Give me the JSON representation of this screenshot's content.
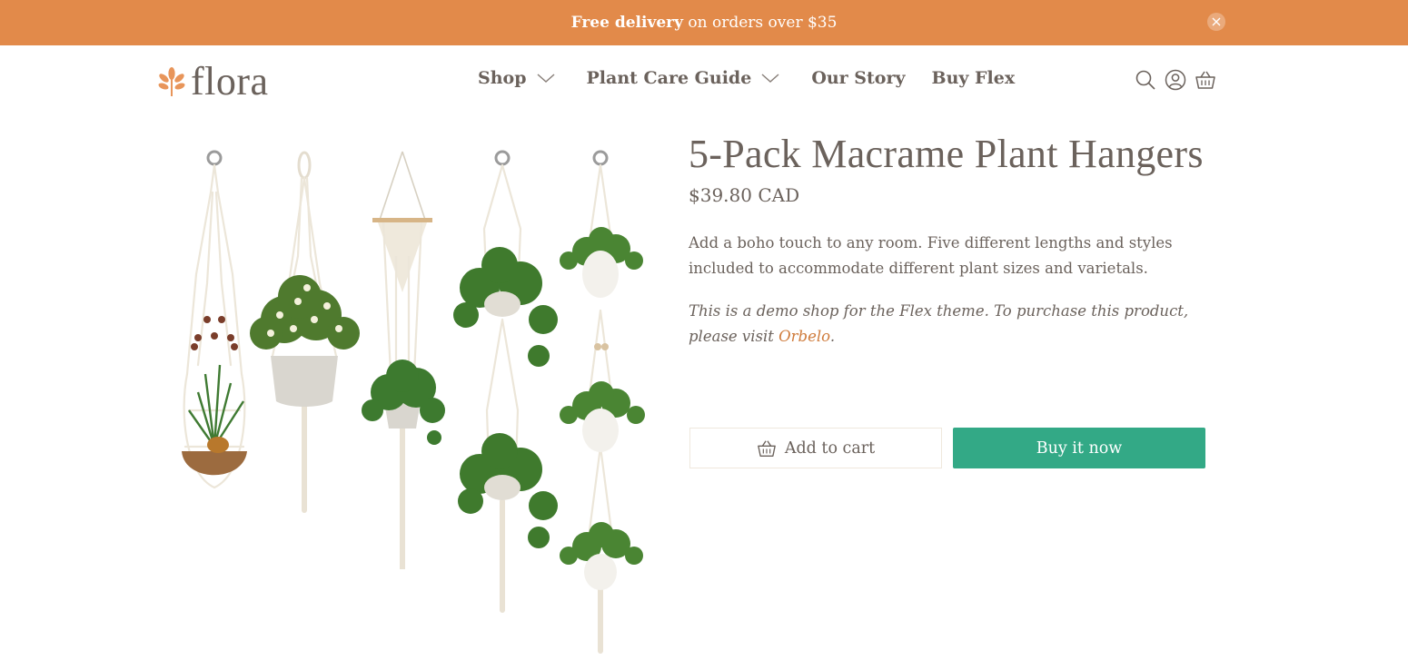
{
  "colors": {
    "announcement_bg": "#e28a4a",
    "link": "#cf7b3b",
    "buy_button": "#33a986",
    "text": "#6b625c"
  },
  "announcement": {
    "bold_text": "Free delivery",
    "text": " on orders over $35",
    "close_icon": "close-icon"
  },
  "header": {
    "logo_text": "flora",
    "logo_icon": "leaf-icon",
    "nav": [
      {
        "label": "Shop",
        "has_dropdown": true
      },
      {
        "label": "Plant Care Guide",
        "has_dropdown": true
      },
      {
        "label": "Our Story",
        "has_dropdown": false
      },
      {
        "label": "Buy Flex",
        "has_dropdown": false
      }
    ],
    "icons": [
      "search-icon",
      "account-icon",
      "cart-icon"
    ]
  },
  "product": {
    "title": "5-Pack Macrame Plant Hangers",
    "price": "$39.80 CAD",
    "description": "Add a boho touch to any room. Five different lengths and styles included to accommodate different plant sizes and varietals.",
    "demo_note_prefix": "This is a demo shop for the Flex theme. To purchase this product, please visit ",
    "demo_link": "Orbelo",
    "demo_note_suffix": ".",
    "add_to_cart_label": "Add to cart",
    "buy_now_label": "Buy it now"
  }
}
